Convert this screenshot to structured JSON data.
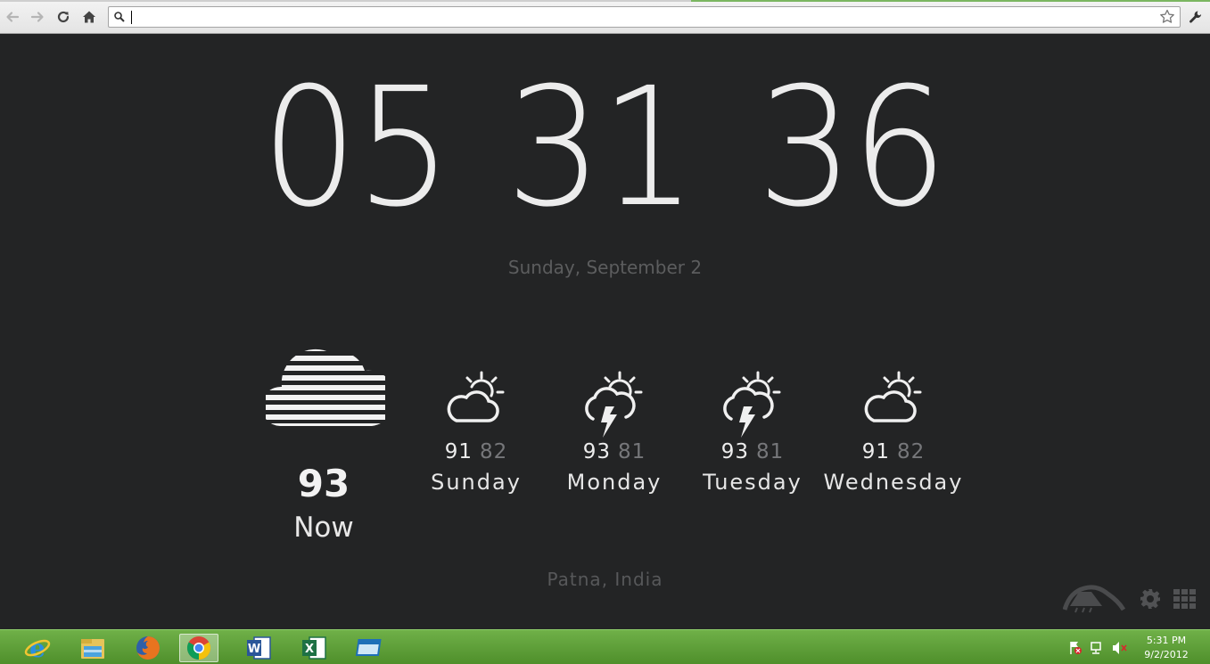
{
  "browser": {
    "omnibox_value": "",
    "buttons": {
      "back": "back-icon",
      "forward": "forward-icon",
      "reload": "reload-icon",
      "home": "home-icon",
      "bookmark": "star-icon",
      "menu": "wrench-icon"
    }
  },
  "clock": {
    "hours": "05",
    "minutes": "31",
    "seconds": "36"
  },
  "date": "Sunday, September 2",
  "weather": {
    "now": {
      "temp": "93",
      "label": "Now",
      "icon": "fog-cloud-icon"
    },
    "forecast": [
      {
        "day": "Sunday",
        "high": "91",
        "low": "82",
        "icon": "partly-cloudy-icon"
      },
      {
        "day": "Monday",
        "high": "93",
        "low": "81",
        "icon": "thunderstorm-sun-icon"
      },
      {
        "day": "Tuesday",
        "high": "93",
        "low": "81",
        "icon": "thunderstorm-sun-icon"
      },
      {
        "day": "Wednesday",
        "high": "91",
        "low": "82",
        "icon": "partly-cloudy-icon"
      }
    ],
    "location": "Patna, India"
  },
  "taskbar": {
    "apps": [
      "internet-explorer-icon",
      "file-explorer-icon",
      "firefox-icon",
      "chrome-icon",
      "word-icon",
      "excel-icon",
      "window-app-icon"
    ],
    "active_app": "chrome-icon",
    "time": "5:31 PM",
    "date": "9/2/2012"
  },
  "colors": {
    "background": "#232425",
    "clock_text": "#ececec",
    "dim_text": "#5c5d5e",
    "taskbar": "#5a9c36"
  }
}
